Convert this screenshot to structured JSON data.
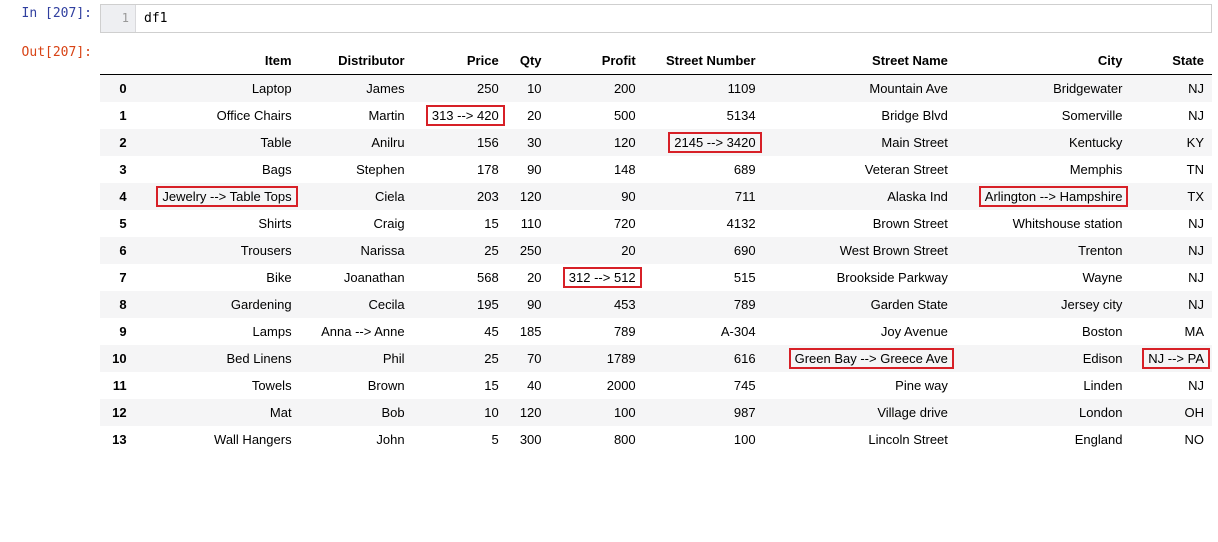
{
  "input": {
    "prompt": "In [207]:",
    "line_number": "1",
    "code": "df1"
  },
  "output": {
    "prompt": "Out[207]:",
    "columns": [
      "Item",
      "Distributor",
      "Price",
      "Qty",
      "Profit",
      "Street Number",
      "Street Name",
      "City",
      "State"
    ],
    "rows": [
      {
        "idx": "0",
        "item": "Laptop",
        "dist": "James",
        "price": "250",
        "qty": "10",
        "profit": "200",
        "snum": "1109",
        "sname": "Mountain Ave",
        "city": "Bridgewater",
        "state": "NJ"
      },
      {
        "idx": "1",
        "item": "Office Chairs",
        "dist": "Martin",
        "price": "313 --> 420",
        "qty": "20",
        "profit": "500",
        "snum": "5134",
        "sname": "Bridge Blvd",
        "city": "Somerville",
        "state": "NJ",
        "hl": [
          "price"
        ]
      },
      {
        "idx": "2",
        "item": "Table",
        "dist": "Anilru",
        "price": "156",
        "qty": "30",
        "profit": "120",
        "snum": "2145 --> 3420",
        "sname": "Main Street",
        "city": "Kentucky",
        "state": "KY",
        "hl": [
          "snum"
        ]
      },
      {
        "idx": "3",
        "item": "Bags",
        "dist": "Stephen",
        "price": "178",
        "qty": "90",
        "profit": "148",
        "snum": "689",
        "sname": "Veteran Street",
        "city": "Memphis",
        "state": "TN"
      },
      {
        "idx": "4",
        "item": "Jewelry --> Table Tops",
        "dist": "Ciela",
        "price": "203",
        "qty": "120",
        "profit": "90",
        "snum": "711",
        "sname": "Alaska Ind",
        "city": "Arlington --> Hampshire",
        "state": "TX",
        "hl": [
          "item",
          "city"
        ]
      },
      {
        "idx": "5",
        "item": "Shirts",
        "dist": "Craig",
        "price": "15",
        "qty": "110",
        "profit": "720",
        "snum": "4132",
        "sname": "Brown Street",
        "city": "Whitshouse station",
        "state": "NJ"
      },
      {
        "idx": "6",
        "item": "Trousers",
        "dist": "Narissa",
        "price": "25",
        "qty": "250",
        "profit": "20",
        "snum": "690",
        "sname": "West Brown Street",
        "city": "Trenton",
        "state": "NJ"
      },
      {
        "idx": "7",
        "item": "Bike",
        "dist": "Joanathan",
        "price": "568",
        "qty": "20",
        "profit": "312 --> 512",
        "snum": "515",
        "sname": "Brookside Parkway",
        "city": "Wayne",
        "state": "NJ",
        "hl": [
          "profit"
        ]
      },
      {
        "idx": "8",
        "item": "Gardening",
        "dist": "Cecila",
        "price": "195",
        "qty": "90",
        "profit": "453",
        "snum": "789",
        "sname": "Garden State",
        "city": "Jersey city",
        "state": "NJ"
      },
      {
        "idx": "9",
        "item": "Lamps",
        "dist": "Anna --> Anne",
        "price": "45",
        "qty": "185",
        "profit": "789",
        "snum": "A-304",
        "sname": "Joy Avenue",
        "city": "Boston",
        "state": "MA"
      },
      {
        "idx": "10",
        "item": "Bed Linens",
        "dist": "Phil",
        "price": "25",
        "qty": "70",
        "profit": "1789",
        "snum": "616",
        "sname": "Green Bay --> Greece Ave",
        "city": "Edison",
        "state": "NJ --> PA",
        "hl": [
          "sname",
          "state"
        ]
      },
      {
        "idx": "11",
        "item": "Towels",
        "dist": "Brown",
        "price": "15",
        "qty": "40",
        "profit": "2000",
        "snum": "745",
        "sname": "Pine way",
        "city": "Linden",
        "state": "NJ"
      },
      {
        "idx": "12",
        "item": "Mat",
        "dist": "Bob",
        "price": "10",
        "qty": "120",
        "profit": "100",
        "snum": "987",
        "sname": "Village drive",
        "city": "London",
        "state": "OH"
      },
      {
        "idx": "13",
        "item": "Wall Hangers",
        "dist": "John",
        "price": "5",
        "qty": "300",
        "profit": "800",
        "snum": "100",
        "sname": "Lincoln Street",
        "city": "England",
        "state": "NO"
      }
    ]
  }
}
